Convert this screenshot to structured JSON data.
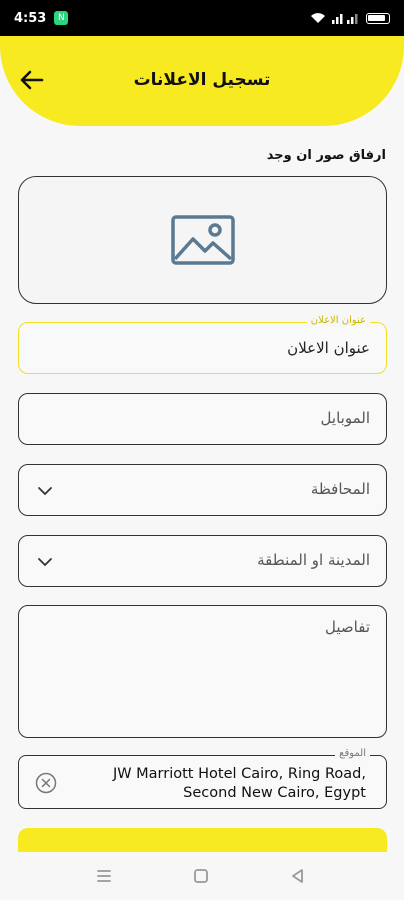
{
  "status_bar": {
    "time": "4:53",
    "notif_badge": "N"
  },
  "header": {
    "title": "تسجيل الاعلانات",
    "back_icon": "arrow-left-icon",
    "color": "#f7ea20"
  },
  "form": {
    "image_label": "ارفاق صور ان وجد",
    "image_icon": "image-placeholder-icon",
    "title_field": {
      "label": "عنوان الاعلان",
      "value": "عنوان الاعلان"
    },
    "mobile_field": {
      "placeholder": "الموبايل"
    },
    "governorate_field": {
      "placeholder": "المحافظة"
    },
    "city_field": {
      "placeholder": "المدينة او المنطقة"
    },
    "details_field": {
      "placeholder": "تفاصيل"
    },
    "location_field": {
      "label": "الموقع",
      "value_line1": "JW Marriott Hotel Cairo, Ring Road,",
      "value_line2": "Second New Cairo, Egypt"
    }
  },
  "nav_bar": {
    "recents_icon": "menu-lines-icon",
    "home_icon": "square-home-icon",
    "back_icon": "triangle-back-icon"
  }
}
